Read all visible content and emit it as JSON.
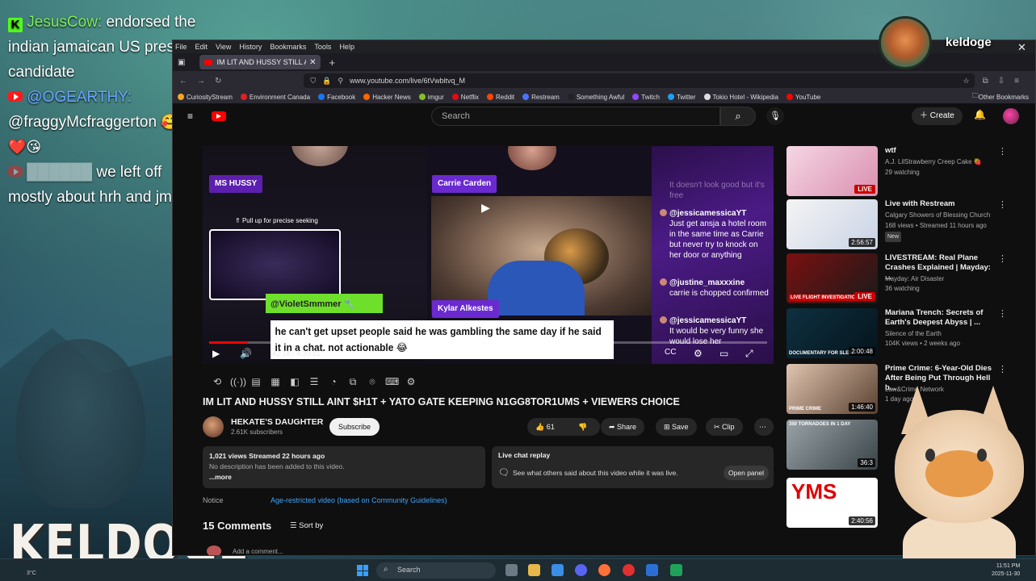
{
  "stream_chat": {
    "line1_user": "JesusCow:",
    "line1_msg": " endorsed the indian jamaican US president candidate",
    "line2_user": "@OGEARTHY:",
    "line2_msg": "@fraggyMcfraggerton",
    "line3_msg": " we left off mostly about hrh and jm"
  },
  "streamer": {
    "name": "keldoge",
    "logo_text": "KELDOGE"
  },
  "browser": {
    "menu": [
      "File",
      "Edit",
      "View",
      "History",
      "Bookmarks",
      "Tools",
      "Help"
    ],
    "tab_title": "IM LIT AND HUSSY STILL AINT",
    "url": "www.youtube.com/live/6tVwbitvq_M",
    "bookmarks": [
      "CuriosityStream",
      "Environment Canada",
      "Facebook",
      "Hacker News",
      "imgur",
      "Netflix",
      "Reddit",
      "Restream",
      "Something Awful",
      "Twitch",
      "Twitter",
      "Tokio Hotel - Wikipedia",
      "YouTube"
    ],
    "other_bookmarks": "Other Bookmarks"
  },
  "youtube": {
    "search_placeholder": "Search",
    "create_label": "Create"
  },
  "player": {
    "label_ms": "MS HUSSY",
    "label_carrie": "Carrie Carden",
    "label_kylar": "Kylar Alkestes",
    "seek_tip": "Pull up for precise seeking",
    "violet_tag": "@VioletSmmmer",
    "caption": "he can't get upset people said he was gambling the same day if he said it in a chat. not actionable 😂",
    "progress_fraction": 0.07,
    "chat": [
      {
        "user": "",
        "text": "It doesn't look good but it's free",
        "faded": true
      },
      {
        "user": "@jessicamessicaYT",
        "text": "Just get ansja a hotel room in the same time as Carrie but never try to knock on her door or anything",
        "faded": false
      },
      {
        "user": "@justine_maxxxine",
        "text": "carrie is chopped confirmed",
        "faded": false
      },
      {
        "user": "@jessicamessicaYT",
        "text": "It would be very funny she would lose her",
        "faded": false
      }
    ]
  },
  "video": {
    "title": "IM LIT AND HUSSY STILL AINT $H1T + YATO GATE KEEPING N1GG8TOR1UMS + VIEWERS CHOICE",
    "channel": "HEKATE'S DAUGHTER",
    "subs": "2.61K subscribers",
    "subscribe": "Subscribe",
    "likes": "61",
    "share": "Share",
    "save": "Save",
    "clip": "Clip",
    "stats": "1,021 views  Streamed 22 hours ago",
    "desc": "No description has been added to this video.",
    "more": "...more",
    "replay_title": "Live chat replay",
    "replay_sub": "See what others said about this video while it was live.",
    "open_panel": "Open panel",
    "notice_label": "Notice",
    "notice_link": "Age-restricted video (based on Community Guidelines)",
    "comments": "15 Comments",
    "sort": "Sort by",
    "add_comment": "Add a comment..."
  },
  "recommendations": [
    {
      "title": "wtf",
      "channel": "A.J. LilStrawberry Creep Cake 🍓",
      "meta": "29 watching",
      "badge": "LIVE",
      "colors": [
        "#f6d6e4",
        "#d98fb0"
      ]
    },
    {
      "title": "Live with Restream",
      "channel": "Calgary Showers of Blessing Church",
      "meta": "168 views • Streamed 11 hours ago",
      "extra": "New",
      "badge": "2:56:57",
      "colors": [
        "#f4f4f4",
        "#c9d3e6"
      ]
    },
    {
      "title": "LIVESTREAM: Real Plane Crashes Explained | Mayday: ...",
      "channel": "Mayday: Air Disaster",
      "meta": "36 watching",
      "badge": "LIVE",
      "colors": [
        "#7a1010",
        "#1a1a1a"
      ]
    },
    {
      "title": "Mariana Trench: Secrets of Earth's Deepest Abyss | ...",
      "channel": "Silence of the Earth",
      "meta": "104K views • 2 weeks ago",
      "badge": "2:00:48",
      "colors": [
        "#0e3040",
        "#05141c"
      ]
    },
    {
      "title": "Prime Crime: 6-Year-Old Dies After Being Put Through Hell b...",
      "channel": "Law&Crime Network",
      "meta": "1 day ago",
      "badge": "1:46:40",
      "colors": [
        "#e0c6b0",
        "#5a4030"
      ]
    },
    {
      "title": "",
      "channel": "",
      "meta": "",
      "badge": "36:3",
      "colors": [
        "#9aa3a8",
        "#3a4448"
      ]
    },
    {
      "title": "",
      "channel": "",
      "meta": "",
      "badge": "2:40:56",
      "colors": [
        "#ffffff",
        "#e8e8e8"
      ]
    }
  ],
  "rec_thumb_text": {
    "mayday": "LIVE FLIGHT INVESTIGATION",
    "trench": "DOCUMENTARY FOR SLEEP",
    "crime": "PRIME CRIME",
    "tornado": "350 TORNADOES IN 1 DAY",
    "yms": "YMS"
  },
  "taskbar": {
    "weather": "3°C",
    "search": "Search",
    "time": "11:51 PM",
    "date": "2025-11-30"
  }
}
